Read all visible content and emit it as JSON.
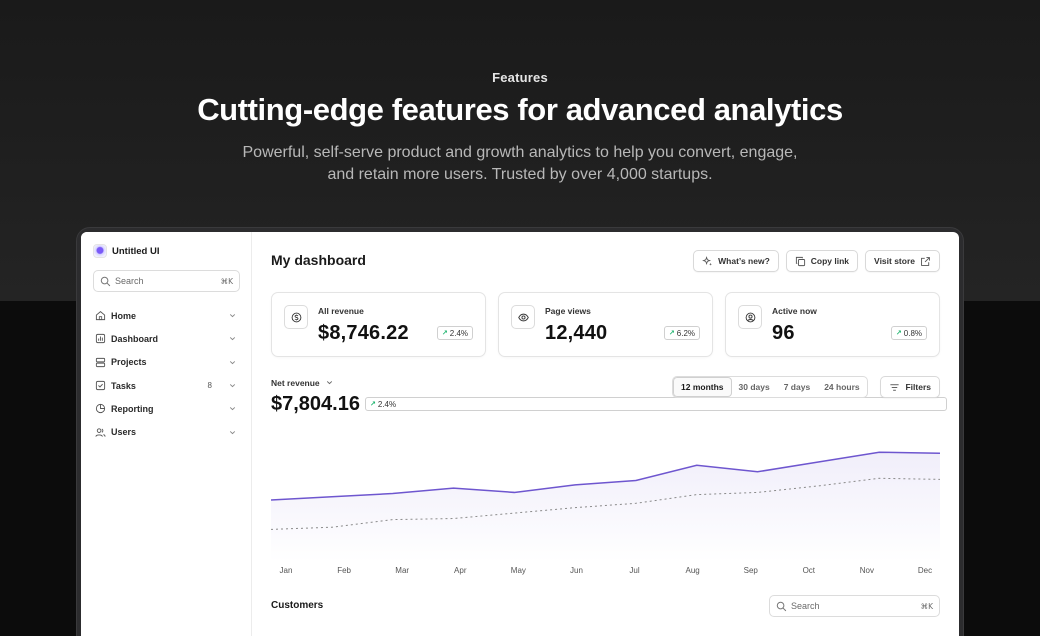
{
  "hero": {
    "eyebrow": "Features",
    "headline": "Cutting-edge features for advanced analytics",
    "subtext": "Powerful, self-serve product and growth analytics to help you convert, engage, and retain more users. Trusted by over 4,000 startups."
  },
  "sidebar": {
    "brand": "Untitled UI",
    "search": {
      "placeholder": "Search",
      "shortcut": "⌘K"
    },
    "items": [
      {
        "label": "Home",
        "icon": "home-icon"
      },
      {
        "label": "Dashboard",
        "icon": "bar-chart-icon"
      },
      {
        "label": "Projects",
        "icon": "layers-icon"
      },
      {
        "label": "Tasks",
        "icon": "check-square-icon",
        "count": "8"
      },
      {
        "label": "Reporting",
        "icon": "pie-chart-icon"
      },
      {
        "label": "Users",
        "icon": "users-icon"
      }
    ]
  },
  "main": {
    "title": "My dashboard",
    "actions": {
      "whats_new": "What’s new?",
      "copy_link": "Copy link",
      "visit_store": "Visit store"
    },
    "stats": [
      {
        "label": "All revenue",
        "value": "$8,746.22",
        "change": "2.4%",
        "icon": "currency-dollar-icon"
      },
      {
        "label": "Page views",
        "value": "12,440",
        "change": "6.2%",
        "icon": "eye-icon"
      },
      {
        "label": "Active now",
        "value": "96",
        "change": "0.8%",
        "icon": "user-circle-icon"
      }
    ],
    "net_revenue": {
      "label": "Net revenue",
      "value": "$7,804.16",
      "change": "2.4%"
    },
    "ranges": [
      "12 months",
      "30 days",
      "7 days",
      "24 hours"
    ],
    "active_range": "12 months",
    "filters": "Filters",
    "customers": {
      "title": "Customers",
      "placeholder": "Search",
      "shortcut": "⌘K"
    }
  },
  "chart_data": {
    "type": "line",
    "categories": [
      "Jan",
      "Feb",
      "Mar",
      "Apr",
      "May",
      "Jun",
      "Jul",
      "Aug",
      "Sep",
      "Oct",
      "Nov",
      "Dec"
    ],
    "series": [
      {
        "values": [
          0.57,
          0.6,
          0.63,
          0.68,
          0.64,
          0.71,
          0.75,
          0.89,
          0.83,
          0.92,
          1.01,
          1.0
        ],
        "style": "solid",
        "color": "#6e56cf"
      },
      {
        "values": [
          0.3,
          0.32,
          0.39,
          0.4,
          0.45,
          0.5,
          0.54,
          0.62,
          0.64,
          0.7,
          0.77,
          0.76
        ],
        "style": "dashed",
        "color": "#8a8a8a"
      }
    ],
    "ylim": [
      0,
      1.15
    ],
    "grid": false
  }
}
